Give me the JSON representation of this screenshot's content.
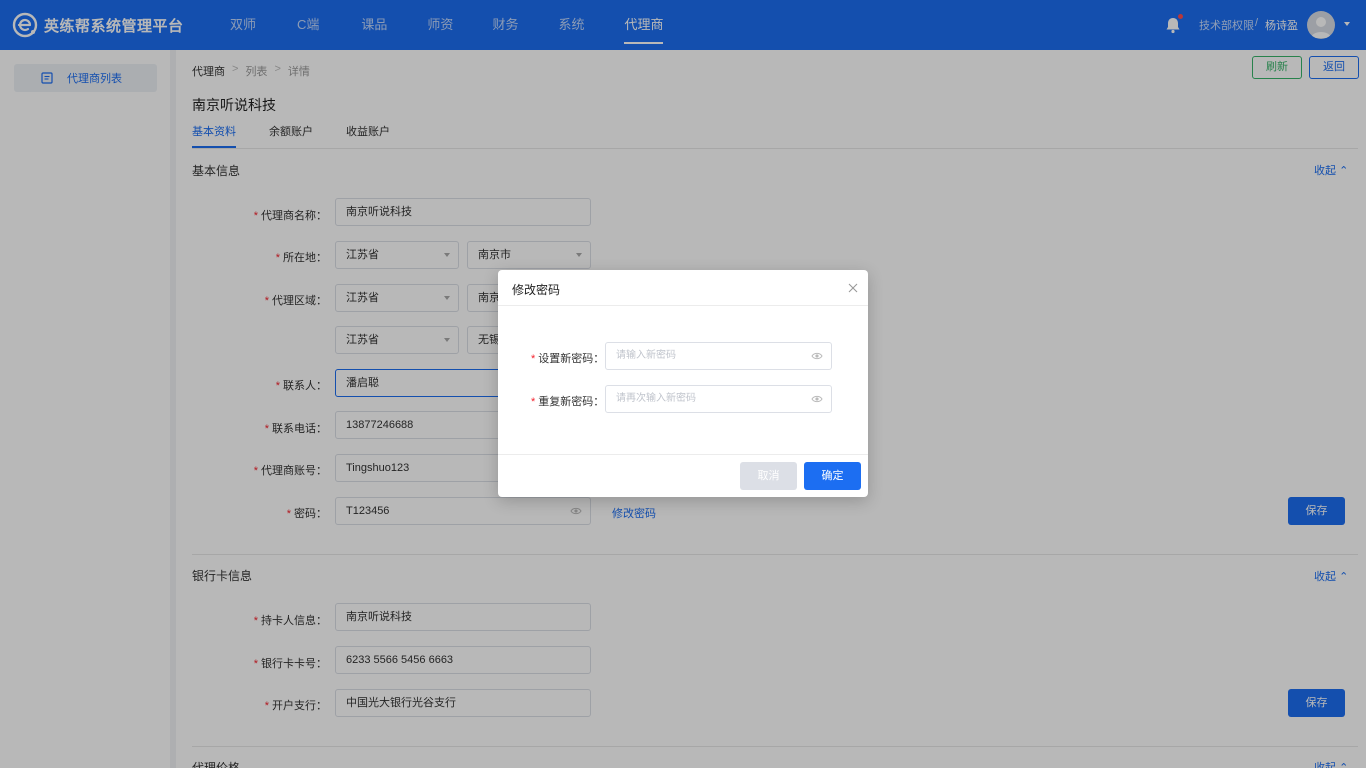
{
  "brand": {
    "name": "英练帮系统管理平台",
    "icon": "brand-logo-icon"
  },
  "nav": [
    {
      "label": "双师"
    },
    {
      "label": "C端"
    },
    {
      "label": "课品"
    },
    {
      "label": "师资"
    },
    {
      "label": "财务"
    },
    {
      "label": "系统"
    },
    {
      "label": "代理商",
      "active": true
    }
  ],
  "header": {
    "department": "技术部权限",
    "separator": "/",
    "username": "杨诗盈",
    "notification_icon": "bell-icon"
  },
  "sidebar": {
    "items": [
      {
        "label": "代理商列表",
        "icon": "list-icon"
      }
    ]
  },
  "breadcrumb": {
    "items": [
      "代理商",
      "列表",
      "详情"
    ],
    "separator": ">"
  },
  "toolbar": {
    "refresh_label": "刷新",
    "back_label": "返回"
  },
  "page": {
    "title": "南京听说科技"
  },
  "tabs": [
    {
      "label": "基本资料",
      "active": true
    },
    {
      "label": "余额账户"
    },
    {
      "label": "收益账户"
    }
  ],
  "basic_info": {
    "title": "基本信息",
    "collapse_label": "收起",
    "save_label": "保存",
    "fields": {
      "agent_name": {
        "label": "代理商名称：",
        "value": "南京听说科技"
      },
      "location": {
        "label": "所在地：",
        "province": "江苏省",
        "city": "南京市"
      },
      "area": {
        "label": "代理区域：",
        "row1_province": "江苏省",
        "row1_city": "南京",
        "row2_province": "江苏省",
        "row2_city": "无锡"
      },
      "contact": {
        "label": "联系人：",
        "value": "潘启聪"
      },
      "phone": {
        "label": "联系电话：",
        "value": "13877246688"
      },
      "account": {
        "label": "代理商账号：",
        "value": "Tingshuo123"
      },
      "password": {
        "label": "密码：",
        "value": "T123456",
        "change_link": "修改密码"
      }
    }
  },
  "bank_info": {
    "title": "银行卡信息",
    "collapse_label": "收起",
    "save_label": "保存",
    "fields": {
      "holder": {
        "label": "持卡人信息：",
        "value": "南京听说科技"
      },
      "card_no": {
        "label": "银行卡卡号：",
        "value": "6233 5566 5456 6663"
      },
      "branch": {
        "label": "开户支行：",
        "value": "中国光大银行光谷支行"
      }
    }
  },
  "agent_price": {
    "title": "代理价格",
    "collapse_label": "收起"
  },
  "modal": {
    "title": "修改密码",
    "new_password": {
      "label": "设置新密码：",
      "placeholder": "请输入新密码"
    },
    "repeat_password": {
      "label": "重复新密码：",
      "placeholder": "请再次输入新密码"
    },
    "cancel_label": "取消",
    "ok_label": "确定"
  },
  "colors": {
    "primary": "#1c6ef2",
    "success": "#38b46a",
    "required": "#f5222d",
    "overlay": "rgba(0,0,0,0.28)"
  }
}
